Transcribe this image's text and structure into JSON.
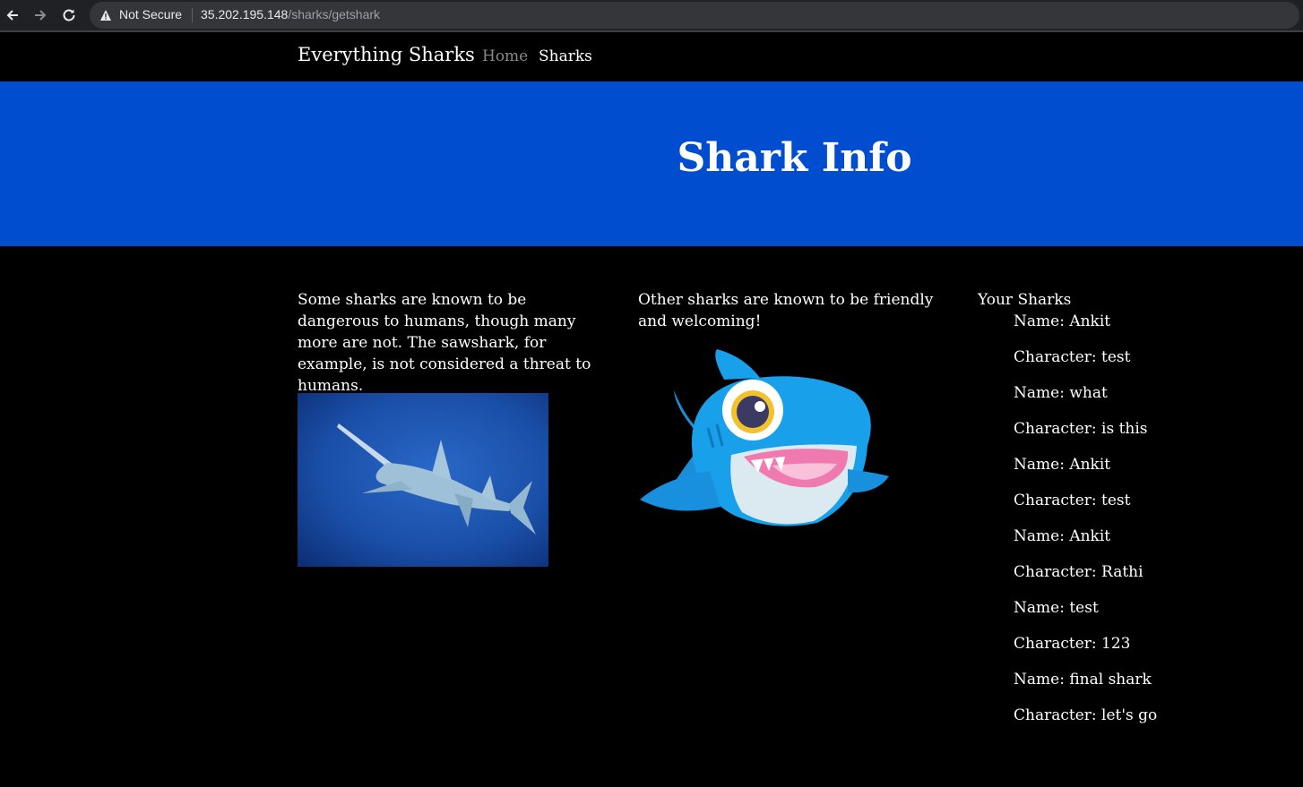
{
  "browser": {
    "security_label": "Not Secure",
    "url_host": "35.202.195.148",
    "url_path": "/sharks/getshark"
  },
  "nav": {
    "brand": "Everything Sharks",
    "links": [
      "Home",
      "Sharks"
    ]
  },
  "hero": {
    "title": "Shark Info"
  },
  "columns": {
    "left_text": "Some sharks are known to be dangerous to humans, though many more are not. The sawshark, for example, is not considered a threat to humans.",
    "middle_text": "Other sharks are known to be friendly and welcoming!",
    "right_title": "Your Sharks"
  },
  "sharks": [
    "Name: Ankit",
    "Character: test",
    "Name: what",
    "Character: is this",
    "Name: Ankit",
    "Character: test",
    "Name: Ankit",
    "Character: Rathi",
    "Name: test",
    "Character: 123",
    "Name: final shark",
    "Character: let's go"
  ],
  "colors": {
    "hero_bg": "#004ecf",
    "page_bg": "#000000",
    "nav_inactive": "#8a8a8a"
  }
}
